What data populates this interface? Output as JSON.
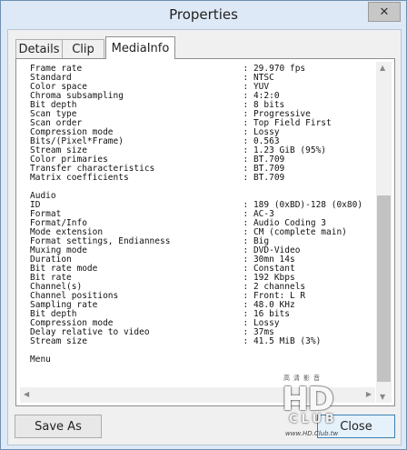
{
  "window": {
    "title": "Properties",
    "close_glyph": "✕"
  },
  "tabs": [
    {
      "label": "Details"
    },
    {
      "label": "Clip"
    },
    {
      "label": "MediaInfo"
    }
  ],
  "mediainfo": {
    "lines": [
      "Frame rate                               : 29.970 fps",
      "Standard                                 : NTSC",
      "Color space                              : YUV",
      "Chroma subsampling                       : 4:2:0",
      "Bit depth                                : 8 bits",
      "Scan type                                : Progressive",
      "Scan order                               : Top Field First",
      "Compression mode                         : Lossy",
      "Bits/(Pixel*Frame)                       : 0.563",
      "Stream size                              : 1.23 GiB (95%)",
      "Color primaries                          : BT.709",
      "Transfer characteristics                 : BT.709",
      "Matrix coefficients                      : BT.709",
      "",
      "Audio",
      "ID                                       : 189 (0xBD)-128 (0x80)",
      "Format                                   : AC-3",
      "Format/Info                              : Audio Coding 3",
      "Mode extension                           : CM (complete main)",
      "Format settings, Endianness              : Big",
      "Muxing mode                              : DVD-Video",
      "Duration                                 : 30mn 14s",
      "Bit rate mode                            : Constant",
      "Bit rate                                 : 192 Kbps",
      "Channel(s)                               : 2 channels",
      "Channel positions                        : Front: L R",
      "Sampling rate                            : 48.0 KHz",
      "Bit depth                                : 16 bits",
      "Compression mode                         : Lossy",
      "Delay relative to video                  : 37ms",
      "Stream size                              : 41.5 MiB (3%)",
      "",
      "Menu"
    ]
  },
  "buttons": {
    "save_as": "Save As",
    "close": "Close"
  },
  "watermark": {
    "top": "高清影音",
    "main": "HD",
    "club": "CLUB",
    "url": "www.HD.Club.tw"
  }
}
